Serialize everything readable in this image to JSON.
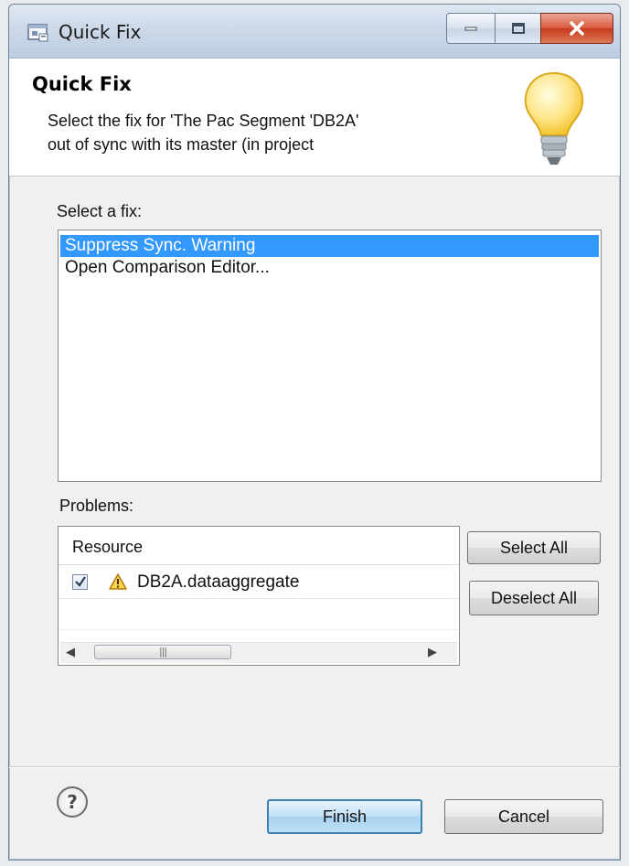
{
  "window": {
    "title": "Quick Fix",
    "controls": [
      "minimize",
      "maximize",
      "close"
    ]
  },
  "header": {
    "title": "Quick Fix",
    "description": "Select the fix for 'The Pac Segment 'DB2A'\nout of sync with its master (in project"
  },
  "fixes": {
    "label": "Select a fix:",
    "items": [
      {
        "label": "Suppress Sync. Warning",
        "selected": true
      },
      {
        "label": "Open Comparison Editor...",
        "selected": false
      }
    ]
  },
  "problems": {
    "label": "Problems:",
    "column_header": "Resource",
    "rows": [
      {
        "checked": true,
        "icon": "warning-icon",
        "resource": "DB2A.dataaggregate"
      }
    ],
    "select_all_label": "Select All",
    "deselect_all_label": "Deselect All"
  },
  "footer": {
    "help_label": "?",
    "finish_label": "Finish",
    "cancel_label": "Cancel"
  },
  "colors": {
    "selection": "#3399ff",
    "close_button": "#c8391d",
    "default_button_border": "#3c7fb1"
  }
}
